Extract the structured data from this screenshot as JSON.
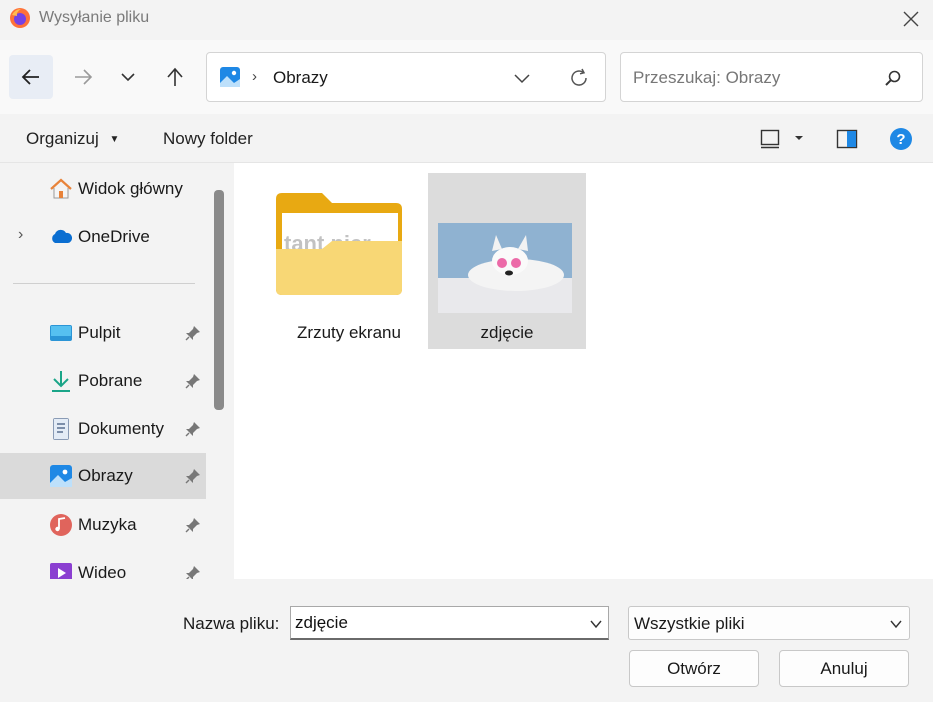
{
  "window": {
    "title": "Wysyłanie pliku",
    "app_icon": "firefox-icon"
  },
  "nav": {
    "back_icon": "arrow-left-icon",
    "forward_icon": "arrow-right-icon",
    "recent_icon": "chevron-down-icon",
    "up_icon": "arrow-up-icon",
    "address": {
      "icon": "pictures-icon",
      "path": "Obrazy"
    },
    "refresh_icon": "refresh-icon",
    "search": {
      "placeholder": "Przeszukaj: Obrazy"
    }
  },
  "commands": {
    "organize": "Organizuj",
    "new_folder": "Nowy folder"
  },
  "sidebar": {
    "items": [
      {
        "label": "Widok główny",
        "icon": "home-icon"
      },
      {
        "label": "OneDrive",
        "icon": "cloud-icon"
      },
      {
        "label": "Pulpit",
        "icon": "desktop-icon"
      },
      {
        "label": "Pobrane",
        "icon": "download-icon"
      },
      {
        "label": "Dokumenty",
        "icon": "document-icon"
      },
      {
        "label": "Obrazy",
        "icon": "pictures-icon"
      },
      {
        "label": "Muzyka",
        "icon": "music-icon"
      },
      {
        "label": "Wideo",
        "icon": "video-icon"
      }
    ]
  },
  "files": [
    {
      "label": "Zrzuty ekranu",
      "type": "folder"
    },
    {
      "label": "zdjęcie",
      "type": "image"
    }
  ],
  "bottom": {
    "filename_label": "Nazwa pliku:",
    "filename_value": "zdjęcie",
    "filetype_value": "Wszystkie pliki",
    "open_label": "Otwórz",
    "cancel_label": "Anuluj"
  },
  "colors": {
    "accent": "#0078d4",
    "selection": "#dadada",
    "folder": "#f8c845"
  }
}
